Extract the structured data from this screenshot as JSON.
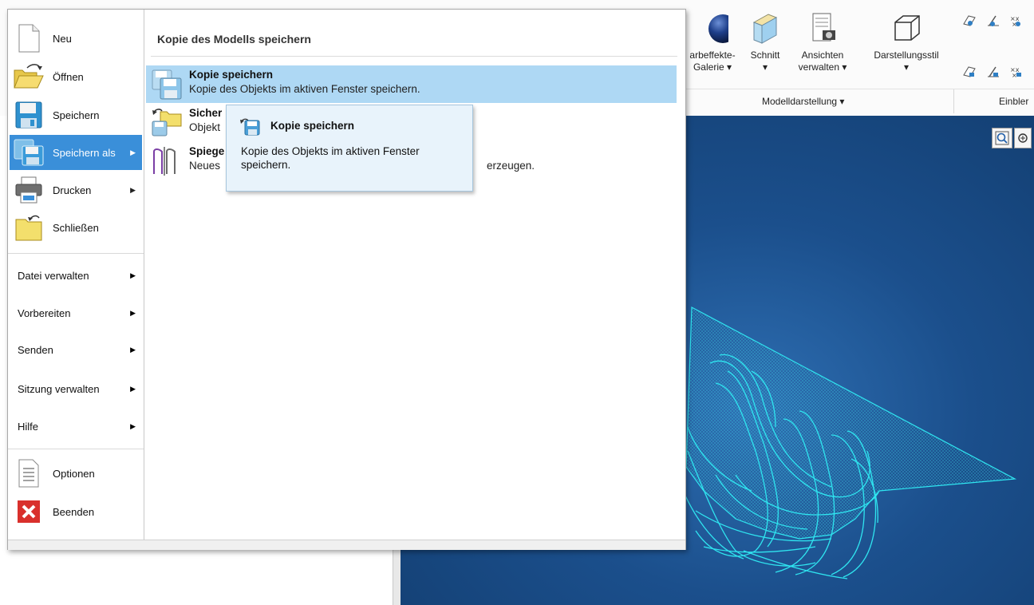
{
  "ribbon": {
    "buttons": [
      {
        "label_1": "arbeffekte-",
        "label_2": "Galerie ▾"
      },
      {
        "label_1": "Schnitt",
        "label_2": "▾"
      },
      {
        "label_1": "Ansichten",
        "label_2": "verwalten ▾"
      },
      {
        "label_1": "Darstellungsstil",
        "label_2": "▾"
      }
    ],
    "group_label": "Modelldarstellung ▾",
    "group_label_2": "Einbler"
  },
  "file_menu": {
    "items": [
      {
        "label": "Neu",
        "icon": "new-document-icon"
      },
      {
        "label": "Öffnen",
        "icon": "open-folder-icon"
      },
      {
        "label": "Speichern",
        "icon": "save-icon"
      },
      {
        "label": "Speichern als",
        "icon": "save-as-icon",
        "arrow": "▶"
      },
      {
        "label": "Drucken",
        "icon": "printer-icon",
        "arrow": "▶"
      },
      {
        "label": "Schließen",
        "icon": "close-folder-icon"
      }
    ],
    "text_items": [
      {
        "label": "Datei verwalten",
        "arrow": "▶"
      },
      {
        "label": "Vorbereiten",
        "arrow": "▶"
      },
      {
        "label": "Senden",
        "arrow": "▶"
      },
      {
        "label": "Sitzung verwalten",
        "arrow": "▶"
      },
      {
        "label": "Hilfe",
        "arrow": "▶"
      }
    ],
    "bottom_items": [
      {
        "label": "Optionen",
        "icon": "options-list-icon"
      },
      {
        "label": "Beenden",
        "icon": "exit-x-icon"
      }
    ]
  },
  "submenu": {
    "title": "Kopie des Modells speichern",
    "items": [
      {
        "title": "Kopie speichern",
        "desc": "Kopie des Objekts im aktiven Fenster speichern."
      },
      {
        "title": "Sicher",
        "desc": "Objekt"
      },
      {
        "title": "Spiege",
        "desc": "Neues",
        "desc_tail": "erzeugen."
      }
    ]
  },
  "tooltip": {
    "title": "Kopie speichern",
    "text": "Kopie des Objekts im aktiven Fenster speichern."
  },
  "colors": {
    "active_menu": "#3a8fd9",
    "highlight_item": "#aed8f4",
    "viewport_bg": "#1b4f8c",
    "wireframe": "#2fe5f0"
  }
}
